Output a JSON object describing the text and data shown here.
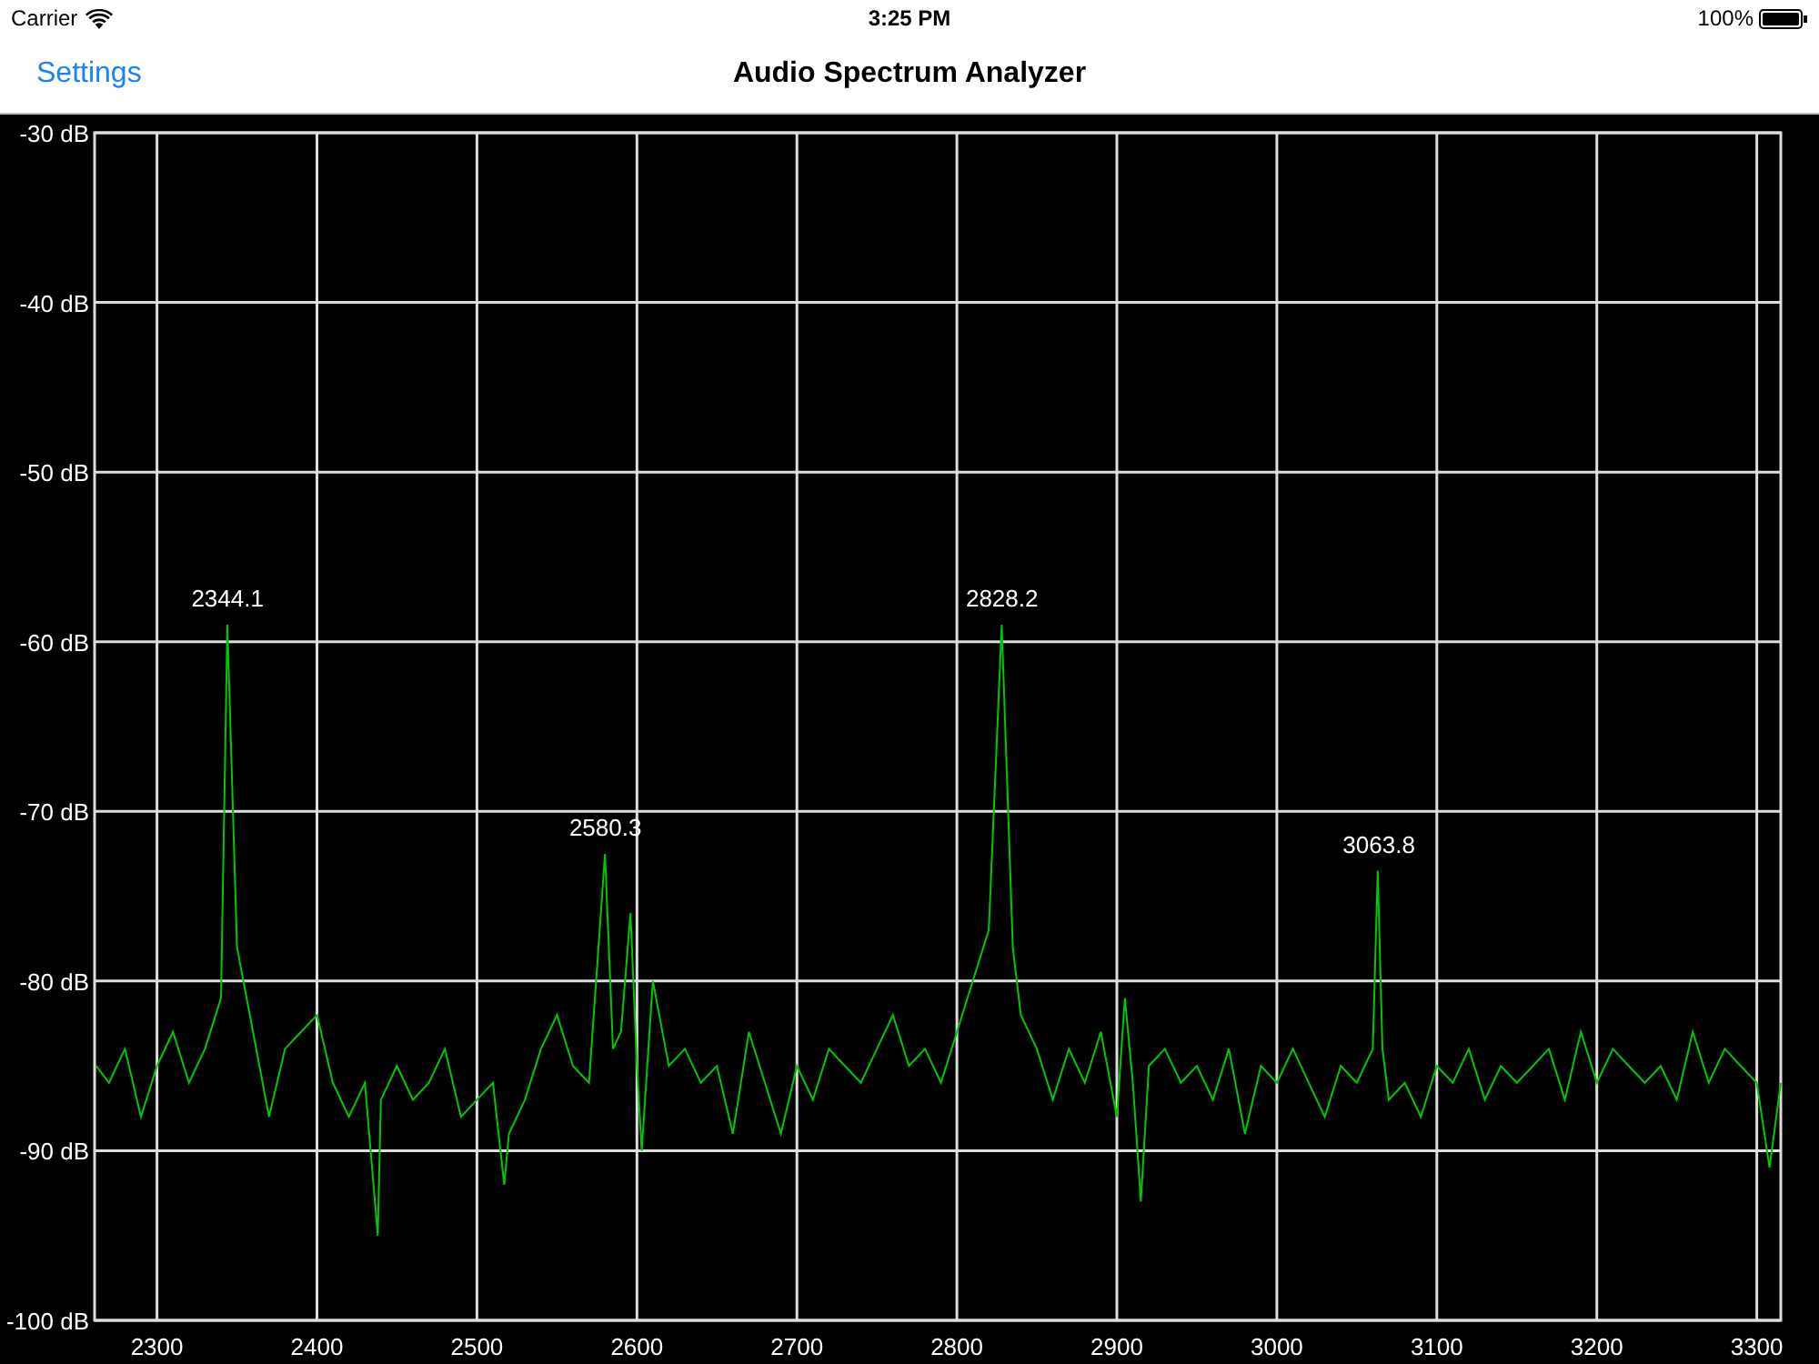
{
  "status_bar": {
    "carrier": "Carrier",
    "time": "3:25 PM",
    "battery": "100%"
  },
  "nav_bar": {
    "back_button": "Settings",
    "title": "Audio Spectrum Analyzer"
  },
  "spectrum": {
    "chart_data": {
      "type": "line",
      "xlim": [
        2261,
        3315
      ],
      "ylim": [
        -100,
        -30
      ],
      "xticks": [
        2300,
        2400,
        2500,
        2600,
        2700,
        2800,
        2900,
        3000,
        3100,
        3200,
        3300
      ],
      "yticks": [
        {
          "value": -30,
          "label": "-30 dB"
        },
        {
          "value": -40,
          "label": "-40 dB"
        },
        {
          "value": -50,
          "label": "-50 dB"
        },
        {
          "value": -60,
          "label": "-60 dB"
        },
        {
          "value": -70,
          "label": "-70 dB"
        },
        {
          "value": -80,
          "label": "-80 dB"
        },
        {
          "value": -90,
          "label": "-90 dB"
        },
        {
          "value": -100,
          "label": "-100 dB"
        }
      ],
      "x": [
        2262,
        2270,
        2280,
        2290,
        2300,
        2310,
        2320,
        2330,
        2340,
        2344,
        2350,
        2360,
        2370,
        2380,
        2390,
        2400,
        2410,
        2420,
        2430,
        2438,
        2440,
        2450,
        2460,
        2470,
        2480,
        2490,
        2500,
        2510,
        2517,
        2520,
        2530,
        2540,
        2550,
        2560,
        2570,
        2580,
        2585,
        2590,
        2596,
        2600,
        2603,
        2610,
        2620,
        2630,
        2640,
        2650,
        2660,
        2670,
        2680,
        2690,
        2700,
        2710,
        2720,
        2730,
        2740,
        2750,
        2760,
        2770,
        2780,
        2790,
        2800,
        2810,
        2820,
        2828,
        2835,
        2840,
        2850,
        2860,
        2870,
        2880,
        2890,
        2900,
        2905,
        2910,
        2915,
        2920,
        2930,
        2940,
        2950,
        2960,
        2970,
        2980,
        2990,
        3000,
        3010,
        3020,
        3030,
        3040,
        3050,
        3060,
        3063,
        3066,
        3070,
        3080,
        3090,
        3100,
        3110,
        3120,
        3130,
        3140,
        3150,
        3160,
        3170,
        3180,
        3190,
        3200,
        3210,
        3220,
        3230,
        3240,
        3250,
        3260,
        3270,
        3280,
        3290,
        3300,
        3308,
        3315
      ],
      "grid": true,
      "series": [
        {
          "color": "#00c800",
          "values": [
            -85,
            -86,
            -84,
            -88,
            -85,
            -83,
            -86,
            -84,
            -81,
            -59,
            -78,
            -83,
            -88,
            -84,
            -83,
            -82,
            -86,
            -88,
            -86,
            -95,
            -87,
            -85,
            -87,
            -86,
            -84,
            -88,
            -87,
            -86,
            -92,
            -89,
            -87,
            -84,
            -82,
            -85,
            -86,
            -72.5,
            -84,
            -83,
            -76,
            -85,
            -90,
            -80,
            -85,
            -84,
            -86,
            -85,
            -89,
            -83,
            -86,
            -89,
            -85,
            -87,
            -84,
            -85,
            -86,
            -84,
            -82,
            -85,
            -84,
            -86,
            -83,
            -80,
            -77,
            -59,
            -78,
            -82,
            -84,
            -87,
            -84,
            -86,
            -83,
            -88,
            -81,
            -86,
            -93,
            -85,
            -84,
            -86,
            -85,
            -87,
            -84,
            -89,
            -85,
            -86,
            -84,
            -86,
            -88,
            -85,
            -86,
            -84,
            -73.5,
            -84,
            -87,
            -86,
            -88,
            -85,
            -86,
            -84,
            -87,
            -85,
            -86,
            -85,
            -84,
            -87,
            -83,
            -86,
            -84,
            -85,
            -86,
            -85,
            -87,
            -83,
            -86,
            -84,
            -85,
            -86,
            -91,
            -86
          ]
        }
      ],
      "annotations": [
        {
          "x": 2344.1,
          "y": -59,
          "text": "2344.1"
        },
        {
          "x": 2580.3,
          "y": -72.5,
          "text": "2580.3"
        },
        {
          "x": 2828.2,
          "y": -59,
          "text": "2828.2"
        },
        {
          "x": 3063.8,
          "y": -73.5,
          "text": "3063.8"
        }
      ]
    }
  }
}
